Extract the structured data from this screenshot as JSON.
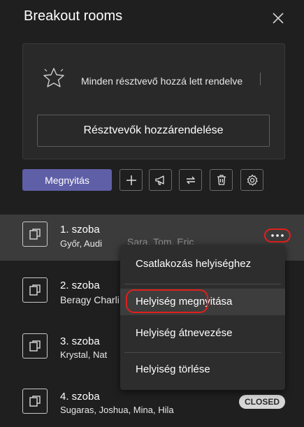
{
  "header": {
    "title": "Breakout rooms",
    "close_icon": "close-icon"
  },
  "assignment_card": {
    "message": "Minden résztvevő hozzá lett rendelve",
    "status_icon": "sparkle-star-icon",
    "assign_button_label": "Résztvevők hozzárendelése"
  },
  "toolbar": {
    "open_button_label": "Megnyitás",
    "icons": [
      "add-icon",
      "announcement-icon",
      "recreate-icon",
      "delete-icon",
      "settings-icon"
    ]
  },
  "rooms": [
    {
      "name": "1. szoba",
      "members": "Győr, Audi",
      "faded_members": "Sara, Tom, Eric"
    },
    {
      "name": "2. szoba",
      "members": "Beragy Charli"
    },
    {
      "name": "3. szoba",
      "members": "Krystal, Nat"
    },
    {
      "name": "4. szoba",
      "members": "Sugaras, Joshua, Mina, Hila",
      "status": "CLOSED"
    }
  ],
  "context_menu": {
    "items": [
      {
        "label": "Csatlakozás helyiséghez"
      },
      {
        "label": "Helyiség megnyitása"
      },
      {
        "label": "Helyiség átnevezése"
      },
      {
        "label": "Helyiség törlése"
      }
    ]
  },
  "colors": {
    "background": "#1f1f1f",
    "accent": "#5f5fa8",
    "highlight": "#e0201c"
  }
}
